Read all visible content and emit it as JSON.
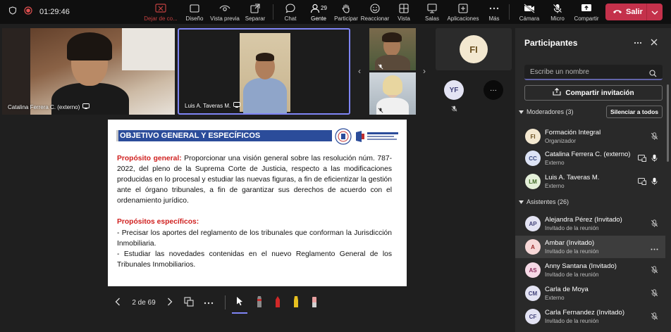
{
  "topbar": {
    "timer": "01:29:46",
    "buttons": [
      {
        "name": "leave-share",
        "label": "Dejar de co..."
      },
      {
        "name": "layout",
        "label": "Diseño"
      },
      {
        "name": "preview",
        "label": "Vista previa"
      },
      {
        "name": "pop-out",
        "label": "Separar"
      },
      {
        "name": "chat",
        "label": "Chat"
      },
      {
        "name": "people",
        "label": "Gente",
        "badge": "29"
      },
      {
        "name": "raise-hand",
        "label": "Participar"
      },
      {
        "name": "react",
        "label": "Reaccionar"
      },
      {
        "name": "view",
        "label": "Vista"
      },
      {
        "name": "rooms",
        "label": "Salas"
      },
      {
        "name": "apps",
        "label": "Aplicaciones"
      },
      {
        "name": "more",
        "label": "Más"
      },
      {
        "name": "camera",
        "label": "Cámara"
      },
      {
        "name": "mic",
        "label": "Micro"
      },
      {
        "name": "share",
        "label": "Compartir"
      }
    ],
    "leave_label": "Salir"
  },
  "videos": {
    "tile1_name": "Catalina Ferrera C. (externo)",
    "tile2_name": "Luis A. Taveras M.",
    "fi_initials": "FI",
    "yf_initials": "YF",
    "more_label": "···"
  },
  "slide": {
    "header": "OBJETIVO GENERAL Y  ESPECÍFICOS",
    "general_label": "Propósito general:",
    "general_text": " Proporcionar una visión general sobre las resolución núm. 787-2022, del pleno de la Suprema Corte de Justicia, respecto a las modificaciones producidas en lo procesal y estudiar las nuevas figuras, a fin de eficientizar la gestión ante el órgano tribunales, a fin de garantizar sus derechos de acuerdo con el ordenamiento jurídico.",
    "specific_label": "Propósitos específicos:",
    "specific_1": "- Precisar los aportes del reglamento de los tribunales que conforman la Jurisdicción Inmobiliaria.",
    "specific_2": "- Estudiar las novedades contenidas en el nuevo Reglamento General de los Tribunales Inmobiliarios."
  },
  "slide_controls": {
    "page": "2 de 69"
  },
  "panel": {
    "title": "Participantes",
    "search_placeholder": "Escribe un nombre",
    "share_invite": "Compartir invitación",
    "moderators_label": "Moderadores (3)",
    "mute_all": "Silenciar a todos",
    "attendees_label": "Asistentes (26)",
    "moderators": [
      {
        "initials": "FI",
        "name": "Formación Integral",
        "role": "Organizador",
        "bg": "#f3e8d0",
        "fg": "#6b5020"
      },
      {
        "initials": "CC",
        "name": "Catalina Ferrera C. (externo)",
        "role": "Externo",
        "bg": "#dde3f5",
        "fg": "#3a4a80"
      },
      {
        "initials": "LM",
        "name": "Luis A. Taveras M.",
        "role": "Externo",
        "bg": "#e4efd8",
        "fg": "#3f6a25"
      }
    ],
    "attendees": [
      {
        "initials": "AP",
        "name": "Alejandra Pérez (Invitado)",
        "role": "Invitado de la reunión",
        "bg": "#e3e3f3",
        "fg": "#42427a"
      },
      {
        "initials": "A",
        "name": "Ambar (Invitado)",
        "role": "Invitado de la reunión",
        "bg": "#f6d7d7",
        "fg": "#9a2b2b"
      },
      {
        "initials": "AS",
        "name": "Anny Santana (Invitado)",
        "role": "Invitado de la reunión",
        "bg": "#f6d9e6",
        "fg": "#8a2a5a"
      },
      {
        "initials": "CM",
        "name": "Carla de Moya",
        "role": "Externo",
        "bg": "#e3e3f3",
        "fg": "#42427a"
      },
      {
        "initials": "CF",
        "name": "Carla Fernandez (Invitado)",
        "role": "Invitado de la reunión",
        "bg": "#e3e3f3",
        "fg": "#42427a"
      }
    ]
  },
  "colors": {
    "accent": "#7f85f5",
    "leave": "#c4314b",
    "slide_header": "#2b4c9a",
    "slide_red": "#d0201f"
  }
}
